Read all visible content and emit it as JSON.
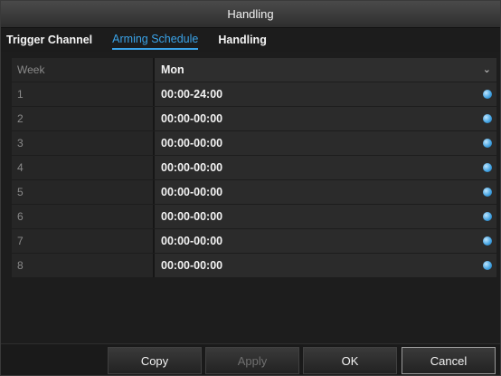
{
  "window": {
    "title": "Handling"
  },
  "tabs": [
    {
      "label": "Trigger Channel",
      "active": false
    },
    {
      "label": "Arming Schedule",
      "active": true
    },
    {
      "label": "Handling",
      "active": false
    }
  ],
  "schedule": {
    "week_label": "Week",
    "week_value": "Mon",
    "rows": [
      {
        "label": "1",
        "time": "00:00-24:00"
      },
      {
        "label": "2",
        "time": "00:00-00:00"
      },
      {
        "label": "3",
        "time": "00:00-00:00"
      },
      {
        "label": "4",
        "time": "00:00-00:00"
      },
      {
        "label": "5",
        "time": "00:00-00:00"
      },
      {
        "label": "6",
        "time": "00:00-00:00"
      },
      {
        "label": "7",
        "time": "00:00-00:00"
      },
      {
        "label": "8",
        "time": "00:00-00:00"
      }
    ]
  },
  "buttons": {
    "copy": "Copy",
    "apply": "Apply",
    "ok": "OK",
    "cancel": "Cancel"
  },
  "colors": {
    "accent": "#3aa3e8",
    "dot": "#3fa0e0"
  },
  "icons": {
    "dropdown": "chevron-down-icon",
    "edit": "edit-dot-icon"
  }
}
